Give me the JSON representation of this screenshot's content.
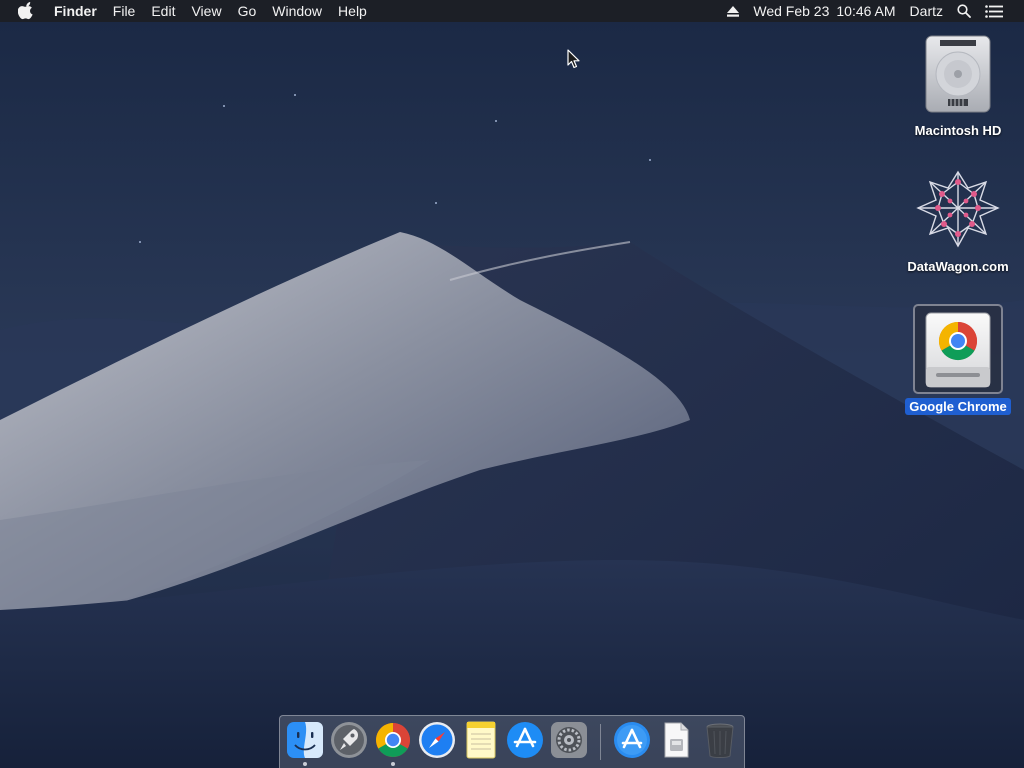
{
  "menubar": {
    "app_name": "Finder",
    "menus": [
      "File",
      "Edit",
      "View",
      "Go",
      "Window",
      "Help"
    ],
    "date": "Wed Feb 23",
    "time": "10:46 AM",
    "user": "Dartz"
  },
  "desktop": {
    "icons": [
      {
        "label": "Macintosh HD",
        "icon": "hard-drive-icon",
        "selected": false
      },
      {
        "label": "DataWagon.com",
        "icon": "network-volume-icon",
        "selected": false
      },
      {
        "label": "Google Chrome",
        "icon": "chrome-disk-image-icon",
        "selected": true
      }
    ]
  },
  "dock": {
    "items": [
      {
        "name": "Finder",
        "icon": "finder-icon",
        "running": true
      },
      {
        "name": "Launchpad",
        "icon": "launchpad-icon",
        "running": false
      },
      {
        "name": "Google Chrome",
        "icon": "chrome-icon",
        "running": true
      },
      {
        "name": "Safari",
        "icon": "safari-icon",
        "running": false
      },
      {
        "name": "Notes",
        "icon": "notes-icon",
        "running": false
      },
      {
        "name": "App Store",
        "icon": "app-store-icon",
        "running": false
      },
      {
        "name": "System Preferences",
        "icon": "system-preferences-icon",
        "running": false
      },
      {
        "name": "Applications",
        "icon": "applications-folder-icon",
        "running": false
      },
      {
        "name": "Downloads",
        "icon": "document-icon",
        "running": false
      },
      {
        "name": "Trash",
        "icon": "trash-icon",
        "running": false
      }
    ]
  },
  "colors": {
    "menubar_bg": "#1c1e24",
    "selection_blue": "#1f5fd1",
    "sky_dark": "#1b2a44",
    "dune_light": "#9aa0ae"
  }
}
